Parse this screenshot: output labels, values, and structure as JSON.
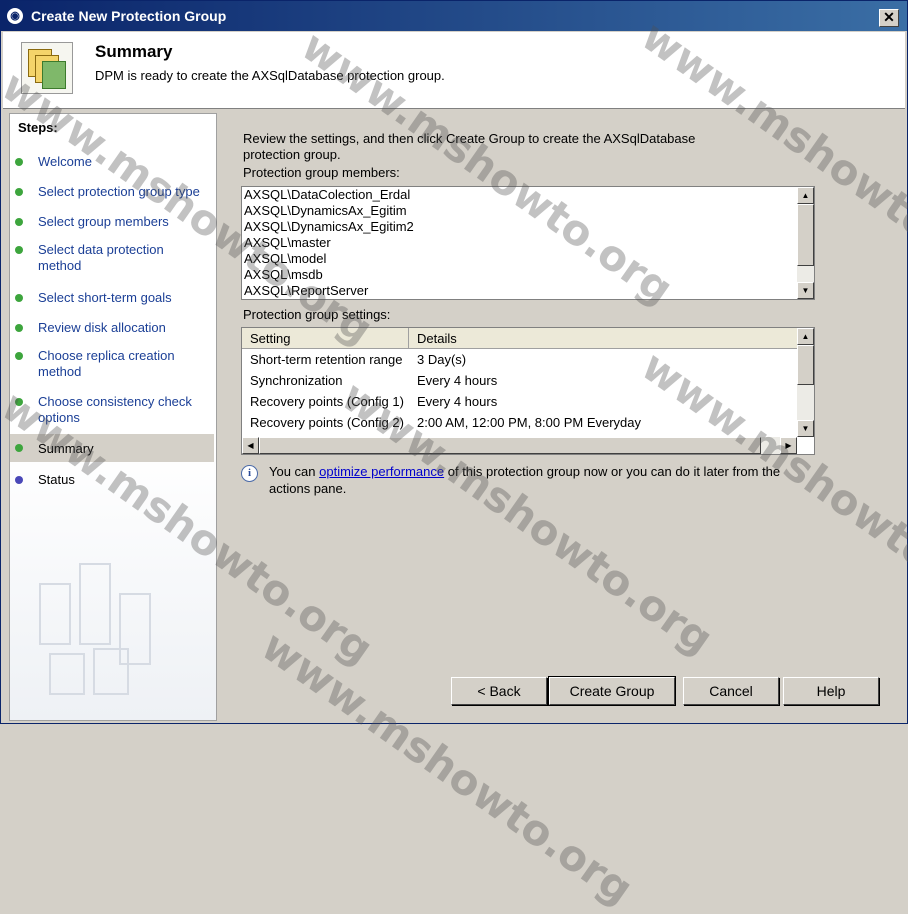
{
  "window": {
    "title": "Create New Protection Group",
    "close_glyph": "✕"
  },
  "header": {
    "title": "Summary",
    "subtitle": "DPM is ready to create the AXSqlDatabase protection group."
  },
  "steps": {
    "title": "Steps:",
    "items": [
      {
        "label": "Welcome",
        "state": "done"
      },
      {
        "label": "Select protection group type",
        "state": "done"
      },
      {
        "label": "Select group members",
        "state": "done"
      },
      {
        "label": "Select data protection method",
        "state": "done"
      },
      {
        "label": "Select short-term goals",
        "state": "done"
      },
      {
        "label": "Review disk allocation",
        "state": "done"
      },
      {
        "label": "Choose replica creation method",
        "state": "done"
      },
      {
        "label": "Choose consistency check options",
        "state": "done"
      },
      {
        "label": "Summary",
        "state": "current"
      },
      {
        "label": "Status",
        "state": "pending"
      }
    ]
  },
  "main": {
    "intro": "Review the settings, and then click Create Group to create the AXSqlDatabase protection group.",
    "members_label": "Protection group members:",
    "members": [
      "AXSQL\\DataColection_Erdal",
      "AXSQL\\DynamicsAx_Egitim",
      "AXSQL\\DynamicsAx_Egitim2",
      "AXSQL\\master",
      "AXSQL\\model",
      "AXSQL\\msdb",
      "AXSQL\\ReportServer"
    ],
    "settings_label": "Protection group settings:",
    "settings_columns": [
      "Setting",
      "Details"
    ],
    "settings_rows": [
      [
        "Short-term retention range",
        "3 Day(s)"
      ],
      [
        "Synchronization",
        "Every 4 hours"
      ],
      [
        "Recovery points (Config 1)",
        "Every 4 hours"
      ],
      [
        "Recovery points (Config 2)",
        "2:00 AM, 12:00 PM, 8:00 PM Everyday"
      ]
    ],
    "info": {
      "prefix": "You can ",
      "link": "optimize performance",
      "suffix": " of this protection group now or you can do it later from the actions pane."
    }
  },
  "buttons": {
    "back": "< Back",
    "create": "Create Group",
    "cancel": "Cancel",
    "help": "Help"
  },
  "watermark": "www.mshowto.org",
  "icons": {
    "info": "i",
    "scroll_up": "▲",
    "scroll_down": "▼",
    "scroll_left": "◀",
    "scroll_right": "▶"
  }
}
